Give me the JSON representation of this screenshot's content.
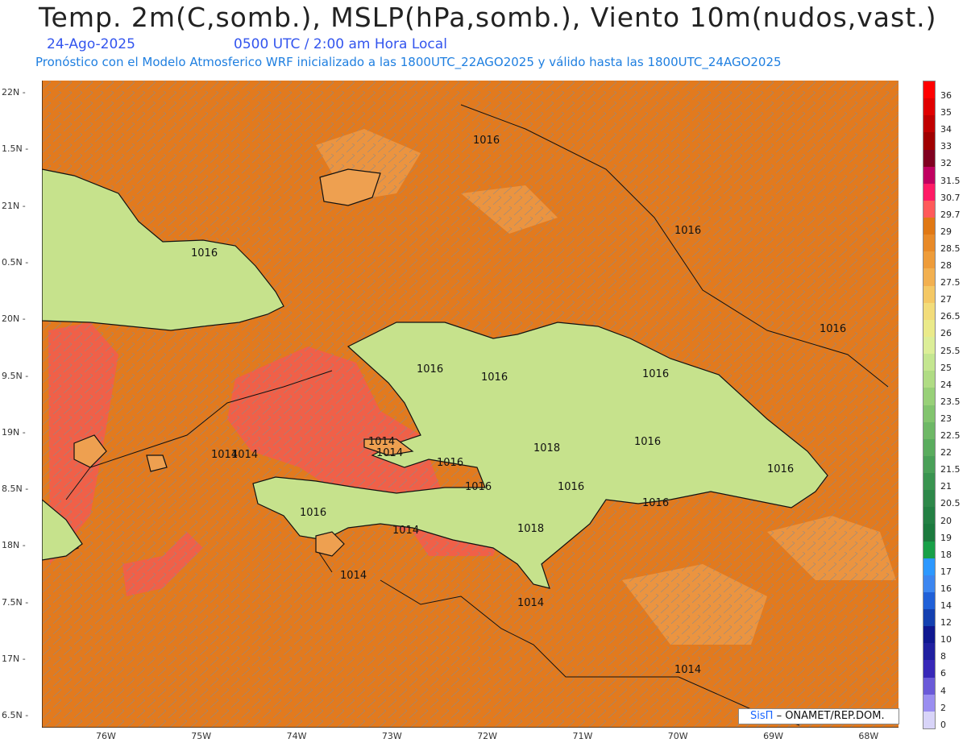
{
  "header": {
    "title": "Temp. 2m(C,somb.), MSLP(hPa,somb.), Viento 10m(nudos,vast.)",
    "date": "24-Ago-2025",
    "time_label": "0500 UTC / 2:00 am Hora Local",
    "subtitle": "Pronóstico con el Modelo Atmosferico WRF inicializado a las 1800UTC_22AGO2025 y válido hasta las  1800UTC_24AGO2025"
  },
  "axes": {
    "lat_labels": [
      "22N",
      "1.5N",
      "21N",
      "0.5N",
      "20N",
      "9.5N",
      "19N",
      "8.5N",
      "18N",
      "7.5N",
      "17N",
      "6.5N"
    ],
    "lon_labels": [
      "76W",
      "75W",
      "74W",
      "73W",
      "72W",
      "71W",
      "70W",
      "69W",
      "68W"
    ]
  },
  "isobars": [
    "1016",
    "1016",
    "1016",
    "1016",
    "1016",
    "1016",
    "1016",
    "1016",
    "1016",
    "1016",
    "1016",
    "1016",
    "1016",
    "1016",
    "1018",
    "1018",
    "1014",
    "1014",
    "1014",
    "1014",
    "1014",
    "1014",
    "1014",
    "1014"
  ],
  "colorbar": {
    "labels": [
      "36",
      "35",
      "34",
      "33",
      "32",
      "31.5",
      "30.7",
      "29.7",
      "29",
      "28.5",
      "28",
      "27.5",
      "27",
      "26.5",
      "26",
      "25.5",
      "25",
      "24",
      "23.5",
      "23",
      "22.5",
      "22",
      "21.5",
      "21",
      "20.5",
      "20",
      "19",
      "18",
      "17",
      "16",
      "14",
      "12",
      "10",
      "8",
      "6",
      "4",
      "2",
      "0"
    ],
    "colors": [
      "#ff0000",
      "#e00000",
      "#c00000",
      "#a00000",
      "#800020",
      "#c00060",
      "#ff1a66",
      "#ff5a5a",
      "#e07814",
      "#e88a28",
      "#ee9c3a",
      "#f2b050",
      "#f4c865",
      "#f2dc7a",
      "#eaea8a",
      "#dcee98",
      "#c4e690",
      "#b0dc84",
      "#98d078",
      "#82c46e",
      "#6eb866",
      "#5aac5e",
      "#4aa058",
      "#3a9450",
      "#2e884a",
      "#248044",
      "#1c7a3e",
      "#18a048",
      "#2c98ff",
      "#3c86f0",
      "#2060d8",
      "#1440b0",
      "#101890",
      "#2020a0",
      "#3828b8",
      "#6a5ad8",
      "#9a8ef0",
      "#d8d4f8"
    ]
  },
  "credit": {
    "brand": "SisΠ",
    "org": "– ONAMET/REP.DOM."
  },
  "colors": {
    "sea": "#e27a1e",
    "warm_sea": "#f06048",
    "land_light": "#c6e28c",
    "land_mid": "#7fc46a",
    "land_high": "#2e9a4a",
    "cold_peak": "#2c7cf0"
  }
}
